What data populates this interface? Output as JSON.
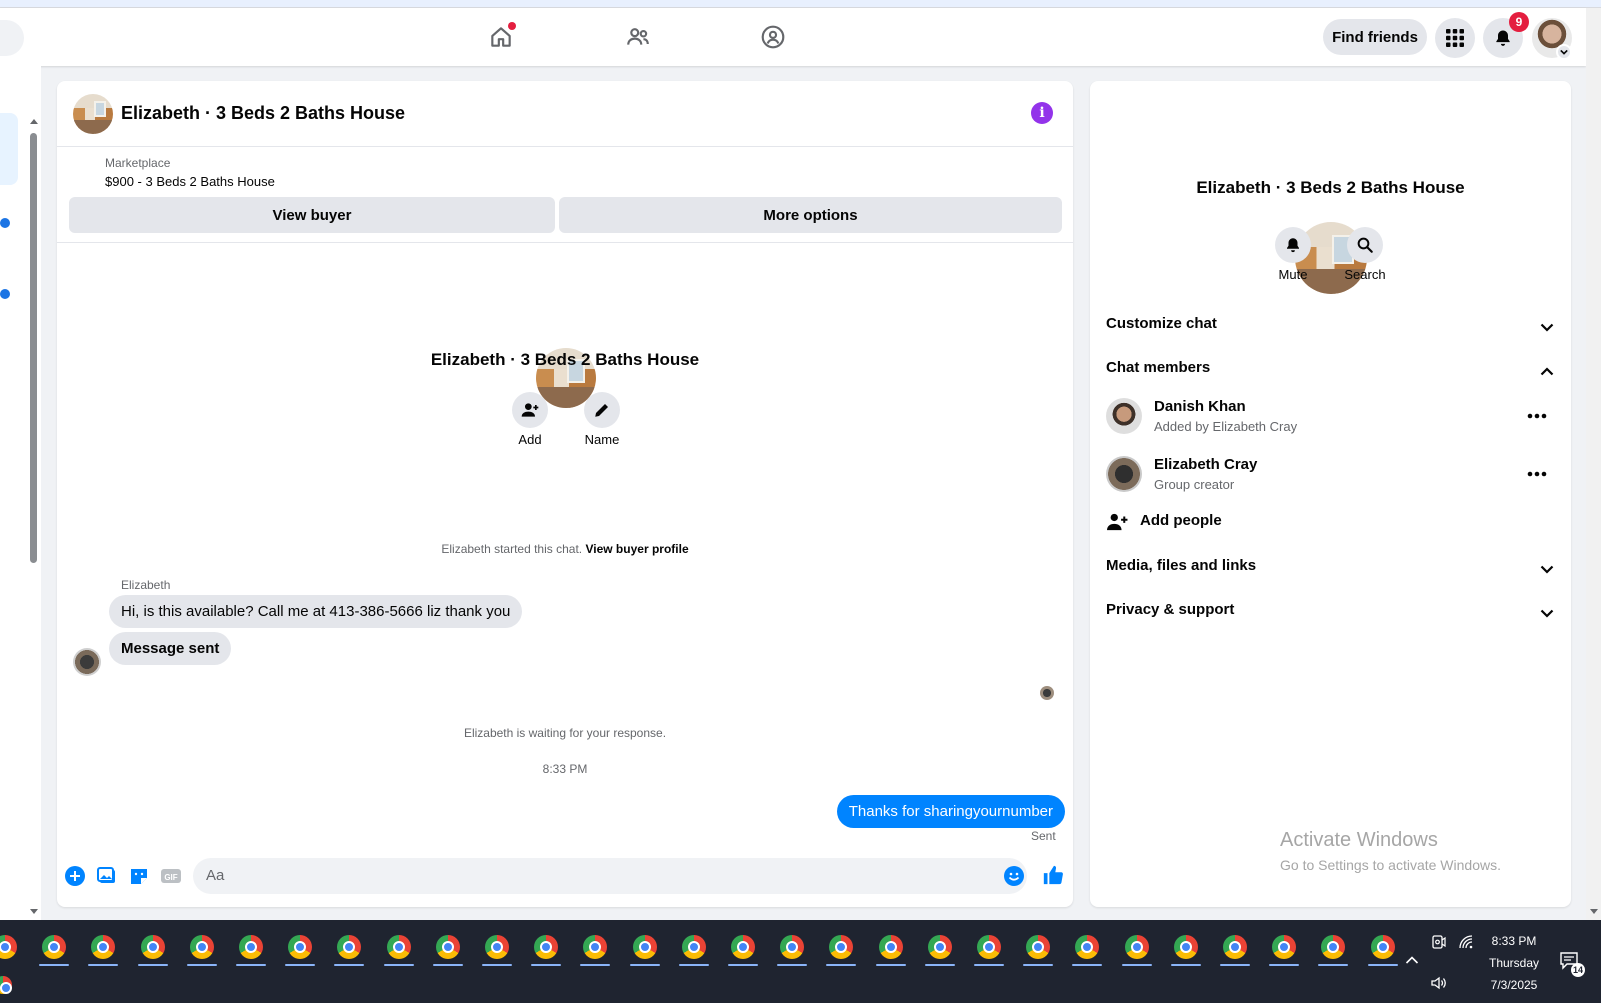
{
  "navbar": {
    "find_friends_label": "Find friends",
    "notification_count": "9"
  },
  "chat": {
    "header_title": "Elizabeth · 3 Beds 2 Baths House",
    "info_label": "i",
    "marketplace_label": "Marketplace",
    "listing_price_title": "$900 - 3 Beds 2 Baths House",
    "view_buyer_label": "View buyer",
    "more_options_label": "More options",
    "center_title": "Elizabeth · 3 Beds 2 Baths House",
    "add_label": "Add",
    "name_label": "Name",
    "started_text": "Elizabeth started this chat.",
    "view_buyer_profile_label": "View buyer profile",
    "sender_name": "Elizabeth",
    "messages_in": [
      "Hi, is this available? Call me at 413-386-5666 liz thank you",
      "Message sent"
    ],
    "waiting_text": "Elizabeth is waiting for your response.",
    "time_text": "8:33 PM",
    "message_out": "Thanks for sharingyournumber",
    "sent_label": "Sent",
    "composer_placeholder": "Aa"
  },
  "right_panel": {
    "title": "Elizabeth · 3 Beds 2 Baths House",
    "mute_label": "Mute",
    "search_label": "Search",
    "sections": {
      "customize_chat": "Customize chat",
      "chat_members": "Chat members",
      "media_files_links": "Media, files and links",
      "privacy_support": "Privacy & support"
    },
    "members": [
      {
        "name": "Danish Khan",
        "subtitle": "Added by Elizabeth Cray"
      },
      {
        "name": "Elizabeth Cray",
        "subtitle": "Group creator"
      }
    ],
    "add_people_label": "Add people"
  },
  "watermark": {
    "line1": "Activate Windows",
    "line2": "Go to Settings to activate Windows."
  },
  "taskbar": {
    "time": "8:33 PM",
    "day": "Thursday",
    "date": "7/3/2025",
    "notification_count": "14"
  },
  "colors": {
    "accent_blue": "#0084ff",
    "info_purple": "#9333ea",
    "badge_red": "#e41e3f"
  }
}
